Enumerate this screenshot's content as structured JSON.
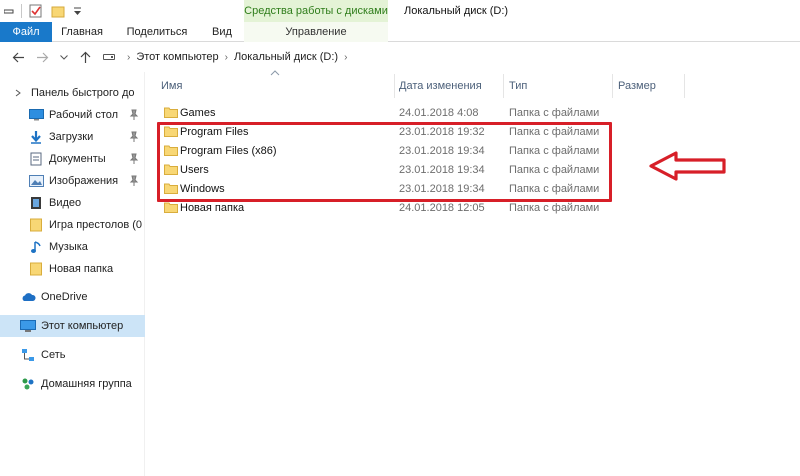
{
  "titlebar": {
    "context_group": "Средства работы с дисками",
    "window_title": "Локальный диск (D:)"
  },
  "ribbon": {
    "tabs": [
      {
        "label": "Файл",
        "active": true
      },
      {
        "label": "Главная"
      },
      {
        "label": "Поделиться"
      },
      {
        "label": "Вид"
      },
      {
        "label": "Управление"
      }
    ]
  },
  "address": {
    "crumbs": [
      "Этот компьютер",
      "Локальный диск (D:)"
    ]
  },
  "nav": {
    "items": [
      {
        "label": "Панель быстрого до",
        "icon": "star-icon"
      },
      {
        "label": "Рабочий стол",
        "icon": "desktop-icon",
        "pinned": true
      },
      {
        "label": "Загрузки",
        "icon": "download-icon",
        "pinned": true
      },
      {
        "label": "Документы",
        "icon": "documents-icon",
        "pinned": true
      },
      {
        "label": "Изображения",
        "icon": "pictures-icon",
        "pinned": true
      },
      {
        "label": "Видео",
        "icon": "video-icon"
      },
      {
        "label": "Игра престолов (0",
        "icon": "folder-icon"
      },
      {
        "label": "Музыка",
        "icon": "music-icon"
      },
      {
        "label": "Новая папка",
        "icon": "folder-icon"
      },
      {
        "label": "OneDrive",
        "icon": "cloud-icon"
      },
      {
        "label": "Этот компьютер",
        "icon": "computer-icon",
        "selected": true
      },
      {
        "label": "Сеть",
        "icon": "network-icon"
      },
      {
        "label": "Домашняя группа",
        "icon": "homegroup-icon"
      }
    ]
  },
  "columns": {
    "name": "Имя",
    "date": "Дата изменения",
    "type": "Тип",
    "size": "Размер"
  },
  "files": [
    {
      "name": "Games",
      "date": "24.01.2018 4:08",
      "type": "Папка с файлами"
    },
    {
      "name": "Program Files",
      "date": "23.01.2018 19:32",
      "type": "Папка с файлами"
    },
    {
      "name": "Program Files (x86)",
      "date": "23.01.2018 19:34",
      "type": "Папка с файлами"
    },
    {
      "name": "Users",
      "date": "23.01.2018 19:34",
      "type": "Папка с файлами"
    },
    {
      "name": "Windows",
      "date": "23.01.2018 19:34",
      "type": "Папка с файлами"
    },
    {
      "name": "Новая папка",
      "date": "24.01.2018 12:05",
      "type": "Папка с файлами"
    }
  ],
  "colors": {
    "accent": "#1979ca",
    "annotation": "#d71f28",
    "folder": "#f8d775"
  }
}
